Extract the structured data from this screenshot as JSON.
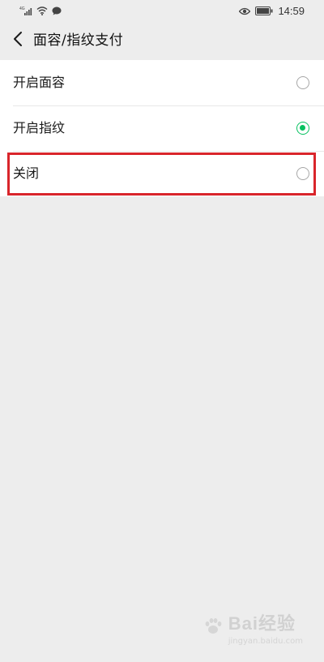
{
  "status_bar": {
    "network": "4G",
    "time": "14:59"
  },
  "header": {
    "title": "面容/指纹支付"
  },
  "options": [
    {
      "label": "开启面容",
      "selected": false
    },
    {
      "label": "开启指纹",
      "selected": true
    },
    {
      "label": "关闭",
      "selected": false
    }
  ],
  "watermark": {
    "text": "Bai经验",
    "sub": "jingyan.baidu.com"
  },
  "colors": {
    "accent": "#07c160",
    "highlight": "#d9252b",
    "background": "#ededed"
  }
}
